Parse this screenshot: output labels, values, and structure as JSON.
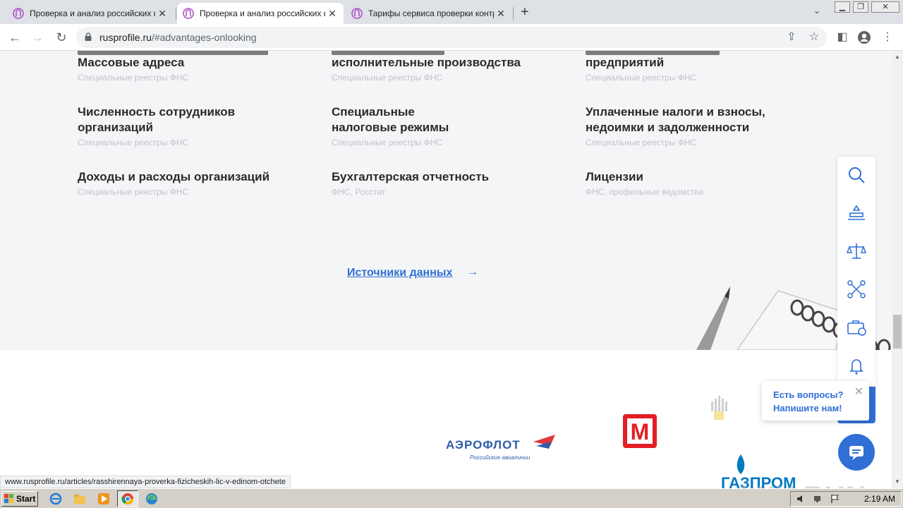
{
  "browser": {
    "tabs": [
      {
        "title": "Проверка и анализ российских юр",
        "active": false
      },
      {
        "title": "Проверка и анализ российских юр",
        "active": true
      },
      {
        "title": "Тарифы сервиса проверки контраг",
        "active": false
      }
    ],
    "url_host": "rusprofile.ru",
    "url_path": "/#advantages-onlooking",
    "status_url": "www.rusprofile.ru/articles/rasshirennaya-proverka-fizicheskih-lic-v-edinom-otchete"
  },
  "features": [
    {
      "title_lines": [
        "Массовые адреса"
      ],
      "source": "Специальные реестры ФНС"
    },
    {
      "title_lines": [
        "исполнительные производства"
      ],
      "source": "Специальные реестры ФНС"
    },
    {
      "title_lines": [
        "предприятий"
      ],
      "source": "Специальные реестры ФНС"
    },
    {
      "title_lines": [
        "Численность сотрудников",
        "организаций"
      ],
      "source": "Специальные реестры ФНС"
    },
    {
      "title_lines": [
        "Специальные",
        "налоговые режимы"
      ],
      "source": "Специальные реестры ФНС"
    },
    {
      "title_lines": [
        "Уплаченные налоги и взносы,",
        "недоимки и задолженности"
      ],
      "source": "Специальные реестры ФНС"
    },
    {
      "title_lines": [
        "Доходы и расходы организаций"
      ],
      "source": "Специальные реестры ФНС"
    },
    {
      "title_lines": [
        "Бухгалтерская отчетность"
      ],
      "source": "ФНС, Росстат"
    },
    {
      "title_lines": [
        "Лицензии"
      ],
      "source": "ФНС, профильные ведомства"
    }
  ],
  "sources_link": "Источники данных",
  "sources_arrow": "→",
  "chat": {
    "line1": "Есть вопросы?",
    "line2": "Напишите нам!",
    "close": "✕"
  },
  "logos": {
    "aeroflot": "АЭРОФЛОТ",
    "aeroflot_sub": "Российские авиалинии",
    "magnit": "М",
    "gazprom": "ГАЗПРОМ"
  },
  "taskbar": {
    "start": "Start",
    "time": "2:19 AM"
  },
  "watermark": "ANY RUN",
  "colors": {
    "accent": "#2f6fd6",
    "section_bg": "#f4f5f7",
    "heading": "#2a2a2a",
    "muted": "#c0c3c8"
  }
}
